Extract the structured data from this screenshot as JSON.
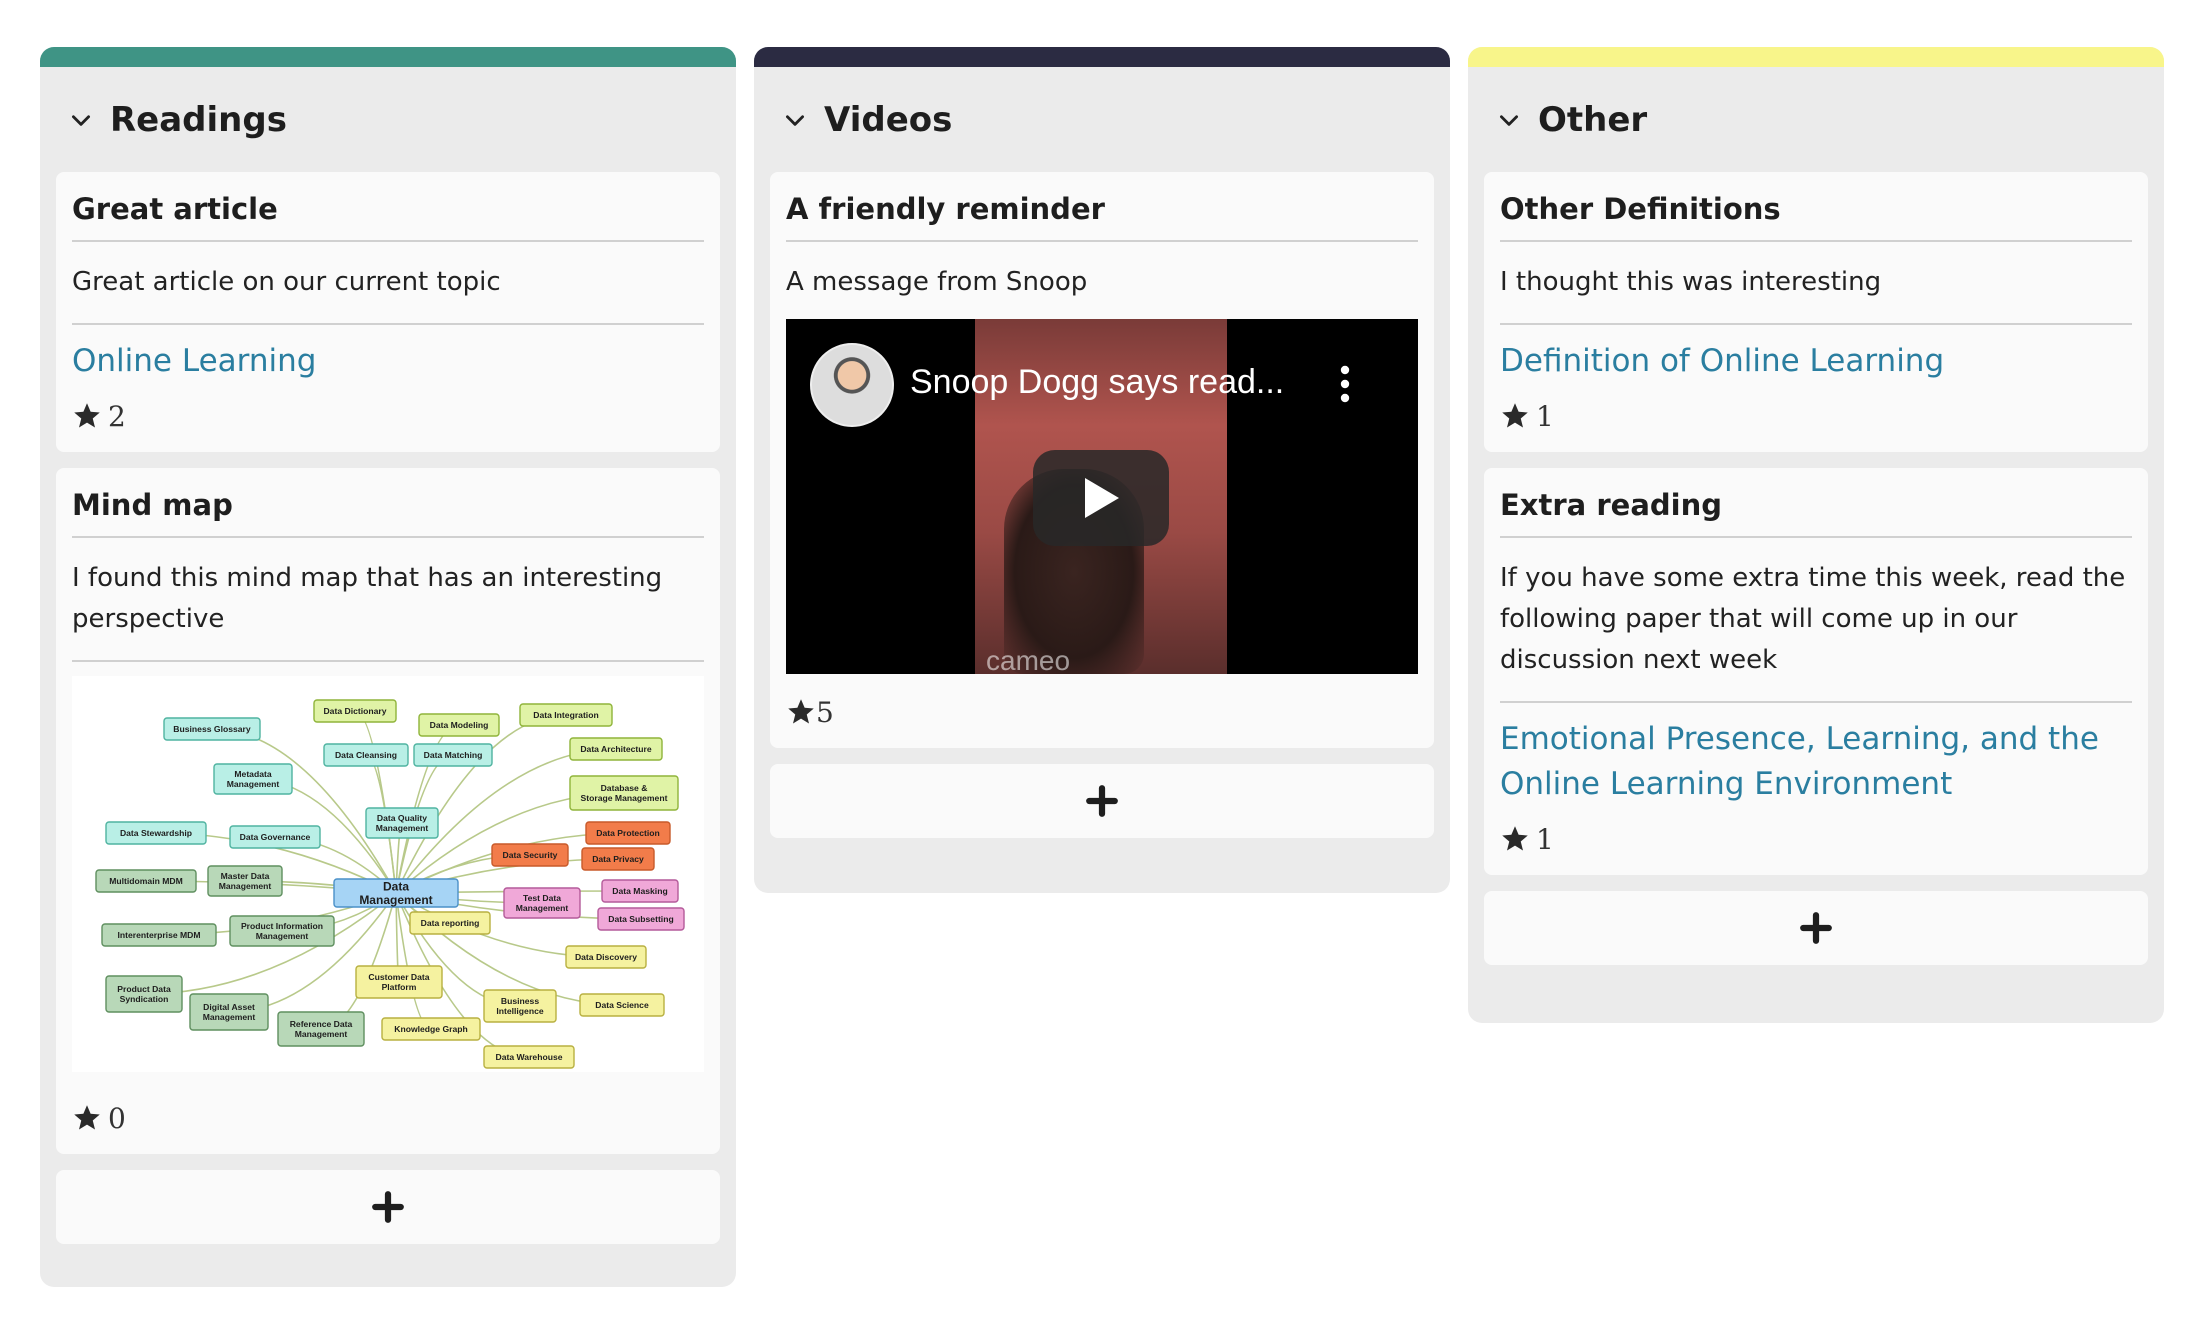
{
  "columns": [
    {
      "title": "Readings",
      "color": "#3f9485",
      "cards": [
        {
          "title": "Great article",
          "body": "Great article on our current topic",
          "link": "Online Learning",
          "stars": "2"
        },
        {
          "title": "Mind map",
          "body": "I found this mind map that has an interesting perspective",
          "stars": "0",
          "mindmap": {
            "center": "Data Management",
            "nodes": [
              "Business Glossary",
              "Data Dictionary",
              "Data Modeling",
              "Data Integration",
              "Metadata Management",
              "Data Cleansing",
              "Data Matching",
              "Data Architecture",
              "Database & Storage Management",
              "Data Quality Management",
              "Data Stewardship",
              "Data Governance",
              "Data Protection",
              "Data Security",
              "Data Privacy",
              "Multidomain MDM",
              "Master Data Management",
              "Test Data Management",
              "Data Masking",
              "Data Subsetting",
              "Data reporting",
              "Interenterprise MDM",
              "Product Information Management",
              "Data Discovery",
              "Customer Data Platform",
              "Product Data Syndication",
              "Digital Asset Management",
              "Business Intelligence",
              "Data Science",
              "Reference Data Management",
              "Knowledge Graph",
              "Data Warehouse"
            ]
          }
        }
      ]
    },
    {
      "title": "Videos",
      "color": "#2b2b42",
      "cards": [
        {
          "title": "A friendly reminder",
          "body": "A message from Snoop",
          "video_title": "Snoop Dogg says read...",
          "video_watermark": "cameo",
          "stars": "5"
        }
      ]
    },
    {
      "title": "Other",
      "color": "#f8f58a",
      "cards": [
        {
          "title": "Other Definitions",
          "body": "I thought this was interesting",
          "link": "Definition of Online Learning",
          "stars": "1"
        },
        {
          "title": "Extra reading",
          "body": "If you have some extra time this week, read the following paper that will come up in our discussion next week",
          "link": "Emotional Presence, Learning, and the Online Learning Environment",
          "stars": "1"
        }
      ]
    }
  ],
  "icons": {
    "collapse": "chevron-down-icon",
    "star": "star-icon",
    "add": "plus-icon",
    "play": "play-icon",
    "menu": "more-vertical-icon"
  }
}
